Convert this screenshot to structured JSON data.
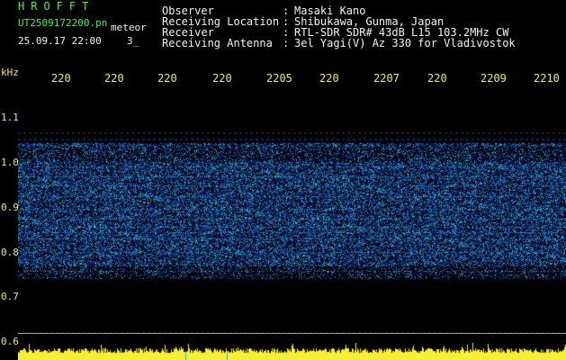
{
  "header": {
    "logo_text": "HROFFT",
    "file_name": "UT2509172200.pn",
    "file_suffix": "meteor",
    "datetime": "25.09.17 22:00",
    "count": "3_"
  },
  "info": [
    {
      "label": "Observer",
      "value": "Masaki Kano"
    },
    {
      "label": "Receiving Location",
      "value": "Shibukawa, Gunma, Japan"
    },
    {
      "label": "Receiver",
      "value": "RTL-SDR SDR# 43dB L15 103.2MHz CW"
    },
    {
      "label": "Receiving Antenna",
      "value": "3el Yagi(V) Az 330 for Vladivostok"
    }
  ],
  "axes": {
    "y_unit": "kHz",
    "x_ticks": [
      "220",
      "220",
      "220",
      "220",
      "2205",
      "220",
      "2207",
      "220",
      "2209",
      "2210"
    ],
    "y_ticks": [
      "1.1",
      "1.0",
      "0.9",
      "0.8",
      "0.7",
      "0.6"
    ]
  },
  "colors": {
    "logo": "#33ff33",
    "filename": "#33ff33",
    "axis_text": "#f5f032",
    "signal_low": "#0a2a8a",
    "signal_mid": "#2a7fd6",
    "signal_high": "#29d6c6",
    "hot": "#e03030",
    "level_bar": "#f5f032"
  }
}
